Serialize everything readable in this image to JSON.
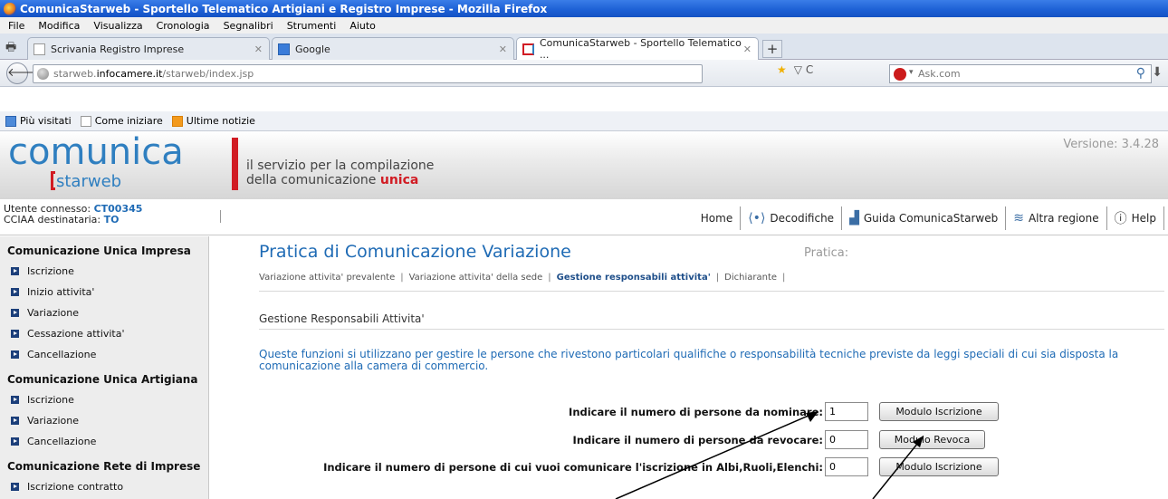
{
  "browser": {
    "window_title": "ComunicaStarweb - Sportello Telematico Artigiani e Registro Imprese - Mozilla Firefox",
    "menu": [
      "File",
      "Modifica",
      "Visualizza",
      "Cronologia",
      "Segnalibri",
      "Strumenti",
      "Aiuto"
    ],
    "tabs": [
      {
        "label": "Scrivania Registro Imprese"
      },
      {
        "label": "Google"
      },
      {
        "label": "ComunicaStarweb - Sportello Telematico ..."
      }
    ],
    "new_tab": "+",
    "url_prefix": "starweb.",
    "url_domain": "infocamere.it",
    "url_path": "/starweb/index.jsp",
    "search_engine": "Ask.com",
    "bookmarks": [
      "Più visitati",
      "Come iniziare",
      "Ultime notizie"
    ]
  },
  "header": {
    "logo_part1": "com",
    "logo_part2": "unica",
    "logo_sub": "starweb",
    "tagline_line1": "il servizio per la compilazione",
    "tagline_line2_a": "della comunicazione ",
    "tagline_line2_b": "unica",
    "version": "Versione: 3.4.28"
  },
  "userbar": {
    "user_label": "Utente connesso: ",
    "user_value": "CT00345",
    "cciaa_label": "CCIAA destinataria: ",
    "cciaa_value": "TO",
    "nav": [
      {
        "label": "Home",
        "icon": ""
      },
      {
        "label": "Decodifiche",
        "icon": "decode-icon"
      },
      {
        "label": "Guida ComunicaStarweb",
        "icon": "guide-icon"
      },
      {
        "label": "Altra regione",
        "icon": "region-icon"
      },
      {
        "label": "Help",
        "icon": "help-icon"
      }
    ]
  },
  "sidebar": {
    "sections": [
      {
        "title": "Comunicazione Unica Impresa",
        "items": [
          "Iscrizione",
          "Inizio attivita'",
          "Variazione",
          "Cessazione attivita'",
          "Cancellazione"
        ]
      },
      {
        "title": "Comunicazione Unica Artigiana",
        "items": [
          "Iscrizione",
          "Variazione",
          "Cancellazione"
        ]
      },
      {
        "title": "Comunicazione Rete di Imprese",
        "items": [
          "Iscrizione contratto"
        ]
      }
    ]
  },
  "main": {
    "title": "Pratica di Comunicazione Variazione",
    "pratica_label": "Pratica:",
    "subnav": [
      "Variazione attivita' prevalente",
      "Variazione attivita' della sede",
      "Gestione responsabili attivita'",
      "Dichiarante"
    ],
    "section_title": "Gestione Responsabili Attivita'",
    "description": "Queste funzioni si utilizzano per gestire le persone che rivestono particolari qualifiche o responsabilità tecniche previste da leggi speciali di cui sia disposta la comunicazione alla camera di commercio.",
    "rows": [
      {
        "label": "Indicare il numero di persone da nominare:",
        "value": "1",
        "button": "Modulo Iscrizione"
      },
      {
        "label": "Indicare il numero di persone da revocare:",
        "value": "0",
        "button": "Modulo Revoca"
      },
      {
        "label": "Indicare il numero di persone di cui vuoi comunicare l'iscrizione in Albi,Ruoli,Elenchi:",
        "value": "0",
        "button": "Modulo Iscrizione"
      }
    ]
  },
  "colors": {
    "accent_blue": "#1f6bb5",
    "brand_red": "#d11c24",
    "title_bar": "#1c5fd4"
  }
}
